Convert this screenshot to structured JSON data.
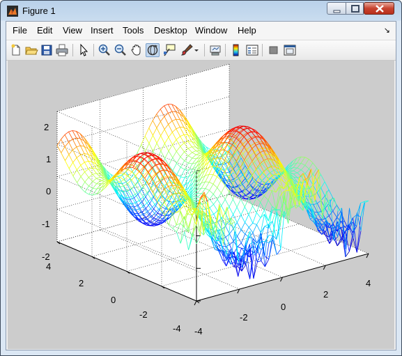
{
  "window": {
    "title": "Figure 1"
  },
  "menu": {
    "items": [
      "File",
      "Edit",
      "View",
      "Insert",
      "Tools",
      "Desktop",
      "Window",
      "Help"
    ],
    "dock_glyph": "↘"
  },
  "toolbar": {
    "buttons": [
      "new-figure",
      "open-file",
      "save-figure",
      "print-figure",
      "edit-plot",
      "zoom-in",
      "zoom-out",
      "pan",
      "rotate-3d",
      "data-cursor",
      "brush",
      "link-plot",
      "colorbar",
      "legend",
      "hide-plot-tools",
      "show-plot-tools"
    ],
    "pressed": "rotate-3d"
  },
  "axes": {
    "z_ticks": [
      "2",
      "1",
      "0",
      "-1",
      "-2"
    ],
    "y_ticks": [
      "4",
      "2",
      "0",
      "-2",
      "-4"
    ],
    "x_ticks": [
      "-4",
      "-2",
      "0",
      "2",
      "4"
    ]
  },
  "chart_data": {
    "type": "mesh-3d",
    "surface": "z = sin(x) + cos(y) with rough noise near the low-y edge",
    "colormap": "jet",
    "xlim": [
      -4,
      4
    ],
    "ylim": [
      -4,
      4
    ],
    "zlim": [
      -2,
      2
    ],
    "grid": true,
    "view": "3d rotated"
  }
}
